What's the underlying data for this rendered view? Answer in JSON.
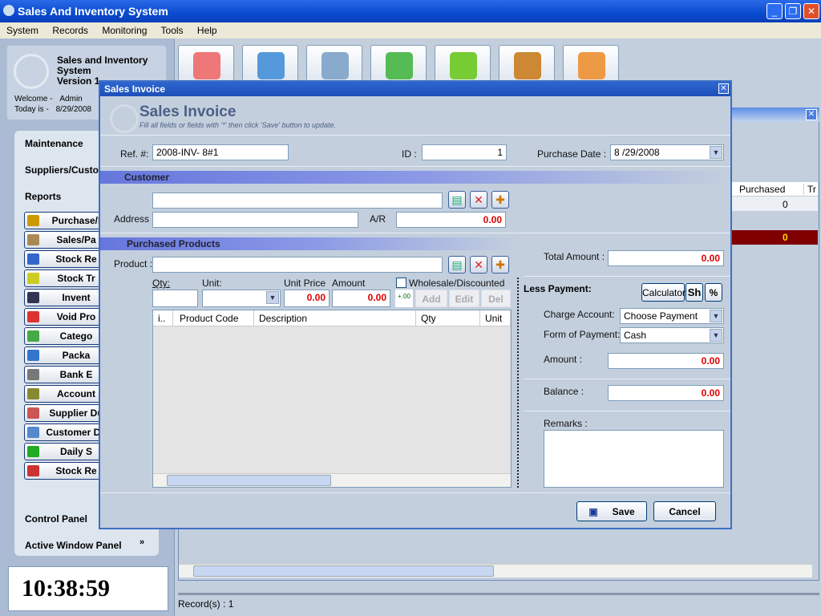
{
  "app": {
    "title": "Sales And Inventory System",
    "window_buttons": [
      "_",
      "❐",
      "✕"
    ]
  },
  "menu": [
    "System",
    "Records",
    "Monitoring",
    "Tools",
    "Help"
  ],
  "info": {
    "name_line1": "Sales and Inventory",
    "name_line2": "System",
    "version": "Version 1",
    "welcome_label": "Welcome -",
    "welcome_user": "Admin",
    "today_label": "Today is -",
    "today": "8/29/2008"
  },
  "nav": {
    "headers": [
      "Maintenance",
      "Suppliers/Customers",
      "Reports"
    ],
    "buttons": [
      "Purchase/I",
      "Sales/Pa",
      "Stock Re",
      "Stock Tr",
      "Invent",
      "Void Pro",
      "Catego",
      "Packa",
      "Bank E",
      "Account",
      "Supplier Du",
      "Customer Du",
      "Daily S",
      "Stock Re"
    ],
    "control_panel": "Control Panel",
    "active_window_panel": "Active Window Panel"
  },
  "clock": "10:38:59",
  "toolbar": [
    "purchase-icon",
    "sales-icon",
    "inventory-icon",
    "receive-icon",
    "folders-icon",
    "reports-icon",
    "users-icon"
  ],
  "background_window": {
    "columns": [
      "Purchased",
      "Tr"
    ],
    "row1": "0",
    "total": "0",
    "records_label": "Record(s) :",
    "records": "1"
  },
  "dialog": {
    "title": "Sales Invoice",
    "heading": "Sales Invoice",
    "subtitle": "Fill all fields or fields with '*' then click 'Save' button to update.",
    "ref_label": "Ref. #:",
    "ref": "2008-INV- 8#1",
    "id_label": "ID :",
    "id": "1",
    "date_label": "Purchase Date :",
    "date": "8 /29/2008",
    "customer_section": "Customer",
    "customer": "",
    "address_label": "Address :",
    "address": "",
    "ar_label": "A/R",
    "ar": "0.00",
    "products_section": "Purchased Products",
    "product_label": "Product :",
    "product": "",
    "qty_label": "Qty:",
    "unit_label": "Unit:",
    "unit_price_label": "Unit Price",
    "amount_label": "Amount",
    "unit_price": "0.00",
    "amount": "0.00",
    "wholesale_label": "Wholesale/Discounted",
    "wholesale": false,
    "decimal_btn": "+.00",
    "add": "Add",
    "edit": "Edit",
    "del": "Del",
    "columns": [
      "i..",
      "Product Code",
      "Description",
      "Qty",
      "Unit"
    ],
    "total_label": "Total Amount :",
    "total": "0.00",
    "less_payment": "Less Payment:",
    "calculator": "Calculator",
    "sh": "Sh",
    "pct": "%",
    "charge_label": "Charge Account:",
    "charge": "Choose Payment",
    "form_label": "Form of Payment:",
    "form": "Cash",
    "pay_amount_label": "Amount :",
    "pay_amount": "0.00",
    "balance_label": "Balance :",
    "balance": "0.00",
    "remarks_label": "Remarks :",
    "remarks": "",
    "save": "Save",
    "cancel": "Cancel"
  }
}
